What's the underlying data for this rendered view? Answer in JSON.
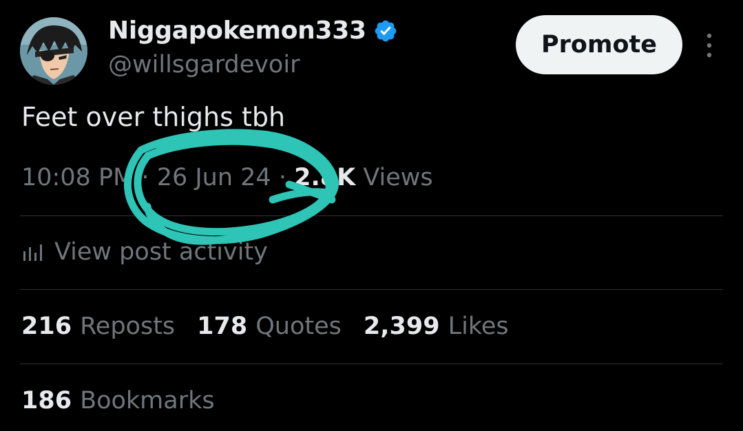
{
  "author": {
    "display_name": "Niggapokemon333",
    "handle": "@willsgardevoir",
    "avatar_icon": "anime-character-avatar",
    "verified_icon": "verified-badge-icon",
    "verified_color": "#1d9bf0"
  },
  "header": {
    "promote_label": "Promote",
    "more_icon": "more-vertical-icon"
  },
  "tweet": {
    "text": "Feet over thighs tbh",
    "time": "10:08 PM",
    "date": "26 Jun 24",
    "views_count": "2.8K",
    "views_label": "Views"
  },
  "activity": {
    "icon": "bar-chart-icon",
    "label": "View post activity"
  },
  "stats": {
    "reposts_count": "216",
    "reposts_label": "Reposts",
    "quotes_count": "178",
    "quotes_label": "Quotes",
    "likes_count": "2,399",
    "likes_label": "Likes",
    "bookmarks_count": "186",
    "bookmarks_label": "Bookmarks"
  },
  "colors": {
    "background": "#000000",
    "text_primary": "#e7e9ea",
    "text_secondary": "#71767b",
    "divider": "#2f3336",
    "promote_bg": "#eff3f4",
    "scribble": "#2ec4b6"
  }
}
